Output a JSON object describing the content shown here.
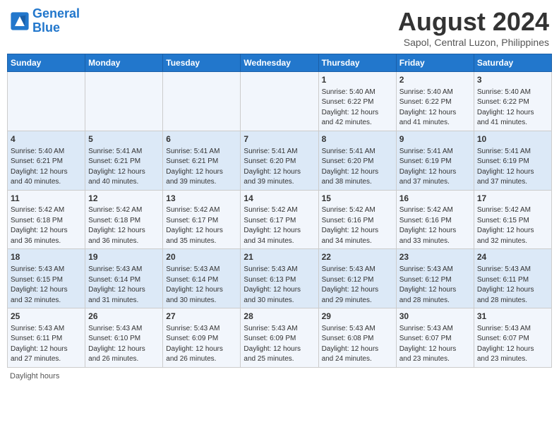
{
  "header": {
    "logo_line1": "General",
    "logo_line2": "Blue",
    "main_title": "August 2024",
    "subtitle": "Sapol, Central Luzon, Philippines"
  },
  "days_of_week": [
    "Sunday",
    "Monday",
    "Tuesday",
    "Wednesday",
    "Thursday",
    "Friday",
    "Saturday"
  ],
  "footer_text": "Daylight hours",
  "weeks": [
    [
      {
        "day": "",
        "content": ""
      },
      {
        "day": "",
        "content": ""
      },
      {
        "day": "",
        "content": ""
      },
      {
        "day": "",
        "content": ""
      },
      {
        "day": "1",
        "content": "Sunrise: 5:40 AM\nSunset: 6:22 PM\nDaylight: 12 hours\nand 42 minutes."
      },
      {
        "day": "2",
        "content": "Sunrise: 5:40 AM\nSunset: 6:22 PM\nDaylight: 12 hours\nand 41 minutes."
      },
      {
        "day": "3",
        "content": "Sunrise: 5:40 AM\nSunset: 6:22 PM\nDaylight: 12 hours\nand 41 minutes."
      }
    ],
    [
      {
        "day": "4",
        "content": "Sunrise: 5:40 AM\nSunset: 6:21 PM\nDaylight: 12 hours\nand 40 minutes."
      },
      {
        "day": "5",
        "content": "Sunrise: 5:41 AM\nSunset: 6:21 PM\nDaylight: 12 hours\nand 40 minutes."
      },
      {
        "day": "6",
        "content": "Sunrise: 5:41 AM\nSunset: 6:21 PM\nDaylight: 12 hours\nand 39 minutes."
      },
      {
        "day": "7",
        "content": "Sunrise: 5:41 AM\nSunset: 6:20 PM\nDaylight: 12 hours\nand 39 minutes."
      },
      {
        "day": "8",
        "content": "Sunrise: 5:41 AM\nSunset: 6:20 PM\nDaylight: 12 hours\nand 38 minutes."
      },
      {
        "day": "9",
        "content": "Sunrise: 5:41 AM\nSunset: 6:19 PM\nDaylight: 12 hours\nand 37 minutes."
      },
      {
        "day": "10",
        "content": "Sunrise: 5:41 AM\nSunset: 6:19 PM\nDaylight: 12 hours\nand 37 minutes."
      }
    ],
    [
      {
        "day": "11",
        "content": "Sunrise: 5:42 AM\nSunset: 6:18 PM\nDaylight: 12 hours\nand 36 minutes."
      },
      {
        "day": "12",
        "content": "Sunrise: 5:42 AM\nSunset: 6:18 PM\nDaylight: 12 hours\nand 36 minutes."
      },
      {
        "day": "13",
        "content": "Sunrise: 5:42 AM\nSunset: 6:17 PM\nDaylight: 12 hours\nand 35 minutes."
      },
      {
        "day": "14",
        "content": "Sunrise: 5:42 AM\nSunset: 6:17 PM\nDaylight: 12 hours\nand 34 minutes."
      },
      {
        "day": "15",
        "content": "Sunrise: 5:42 AM\nSunset: 6:16 PM\nDaylight: 12 hours\nand 34 minutes."
      },
      {
        "day": "16",
        "content": "Sunrise: 5:42 AM\nSunset: 6:16 PM\nDaylight: 12 hours\nand 33 minutes."
      },
      {
        "day": "17",
        "content": "Sunrise: 5:42 AM\nSunset: 6:15 PM\nDaylight: 12 hours\nand 32 minutes."
      }
    ],
    [
      {
        "day": "18",
        "content": "Sunrise: 5:43 AM\nSunset: 6:15 PM\nDaylight: 12 hours\nand 32 minutes."
      },
      {
        "day": "19",
        "content": "Sunrise: 5:43 AM\nSunset: 6:14 PM\nDaylight: 12 hours\nand 31 minutes."
      },
      {
        "day": "20",
        "content": "Sunrise: 5:43 AM\nSunset: 6:14 PM\nDaylight: 12 hours\nand 30 minutes."
      },
      {
        "day": "21",
        "content": "Sunrise: 5:43 AM\nSunset: 6:13 PM\nDaylight: 12 hours\nand 30 minutes."
      },
      {
        "day": "22",
        "content": "Sunrise: 5:43 AM\nSunset: 6:12 PM\nDaylight: 12 hours\nand 29 minutes."
      },
      {
        "day": "23",
        "content": "Sunrise: 5:43 AM\nSunset: 6:12 PM\nDaylight: 12 hours\nand 28 minutes."
      },
      {
        "day": "24",
        "content": "Sunrise: 5:43 AM\nSunset: 6:11 PM\nDaylight: 12 hours\nand 28 minutes."
      }
    ],
    [
      {
        "day": "25",
        "content": "Sunrise: 5:43 AM\nSunset: 6:11 PM\nDaylight: 12 hours\nand 27 minutes."
      },
      {
        "day": "26",
        "content": "Sunrise: 5:43 AM\nSunset: 6:10 PM\nDaylight: 12 hours\nand 26 minutes."
      },
      {
        "day": "27",
        "content": "Sunrise: 5:43 AM\nSunset: 6:09 PM\nDaylight: 12 hours\nand 26 minutes."
      },
      {
        "day": "28",
        "content": "Sunrise: 5:43 AM\nSunset: 6:09 PM\nDaylight: 12 hours\nand 25 minutes."
      },
      {
        "day": "29",
        "content": "Sunrise: 5:43 AM\nSunset: 6:08 PM\nDaylight: 12 hours\nand 24 minutes."
      },
      {
        "day": "30",
        "content": "Sunrise: 5:43 AM\nSunset: 6:07 PM\nDaylight: 12 hours\nand 23 minutes."
      },
      {
        "day": "31",
        "content": "Sunrise: 5:43 AM\nSunset: 6:07 PM\nDaylight: 12 hours\nand 23 minutes."
      }
    ]
  ]
}
